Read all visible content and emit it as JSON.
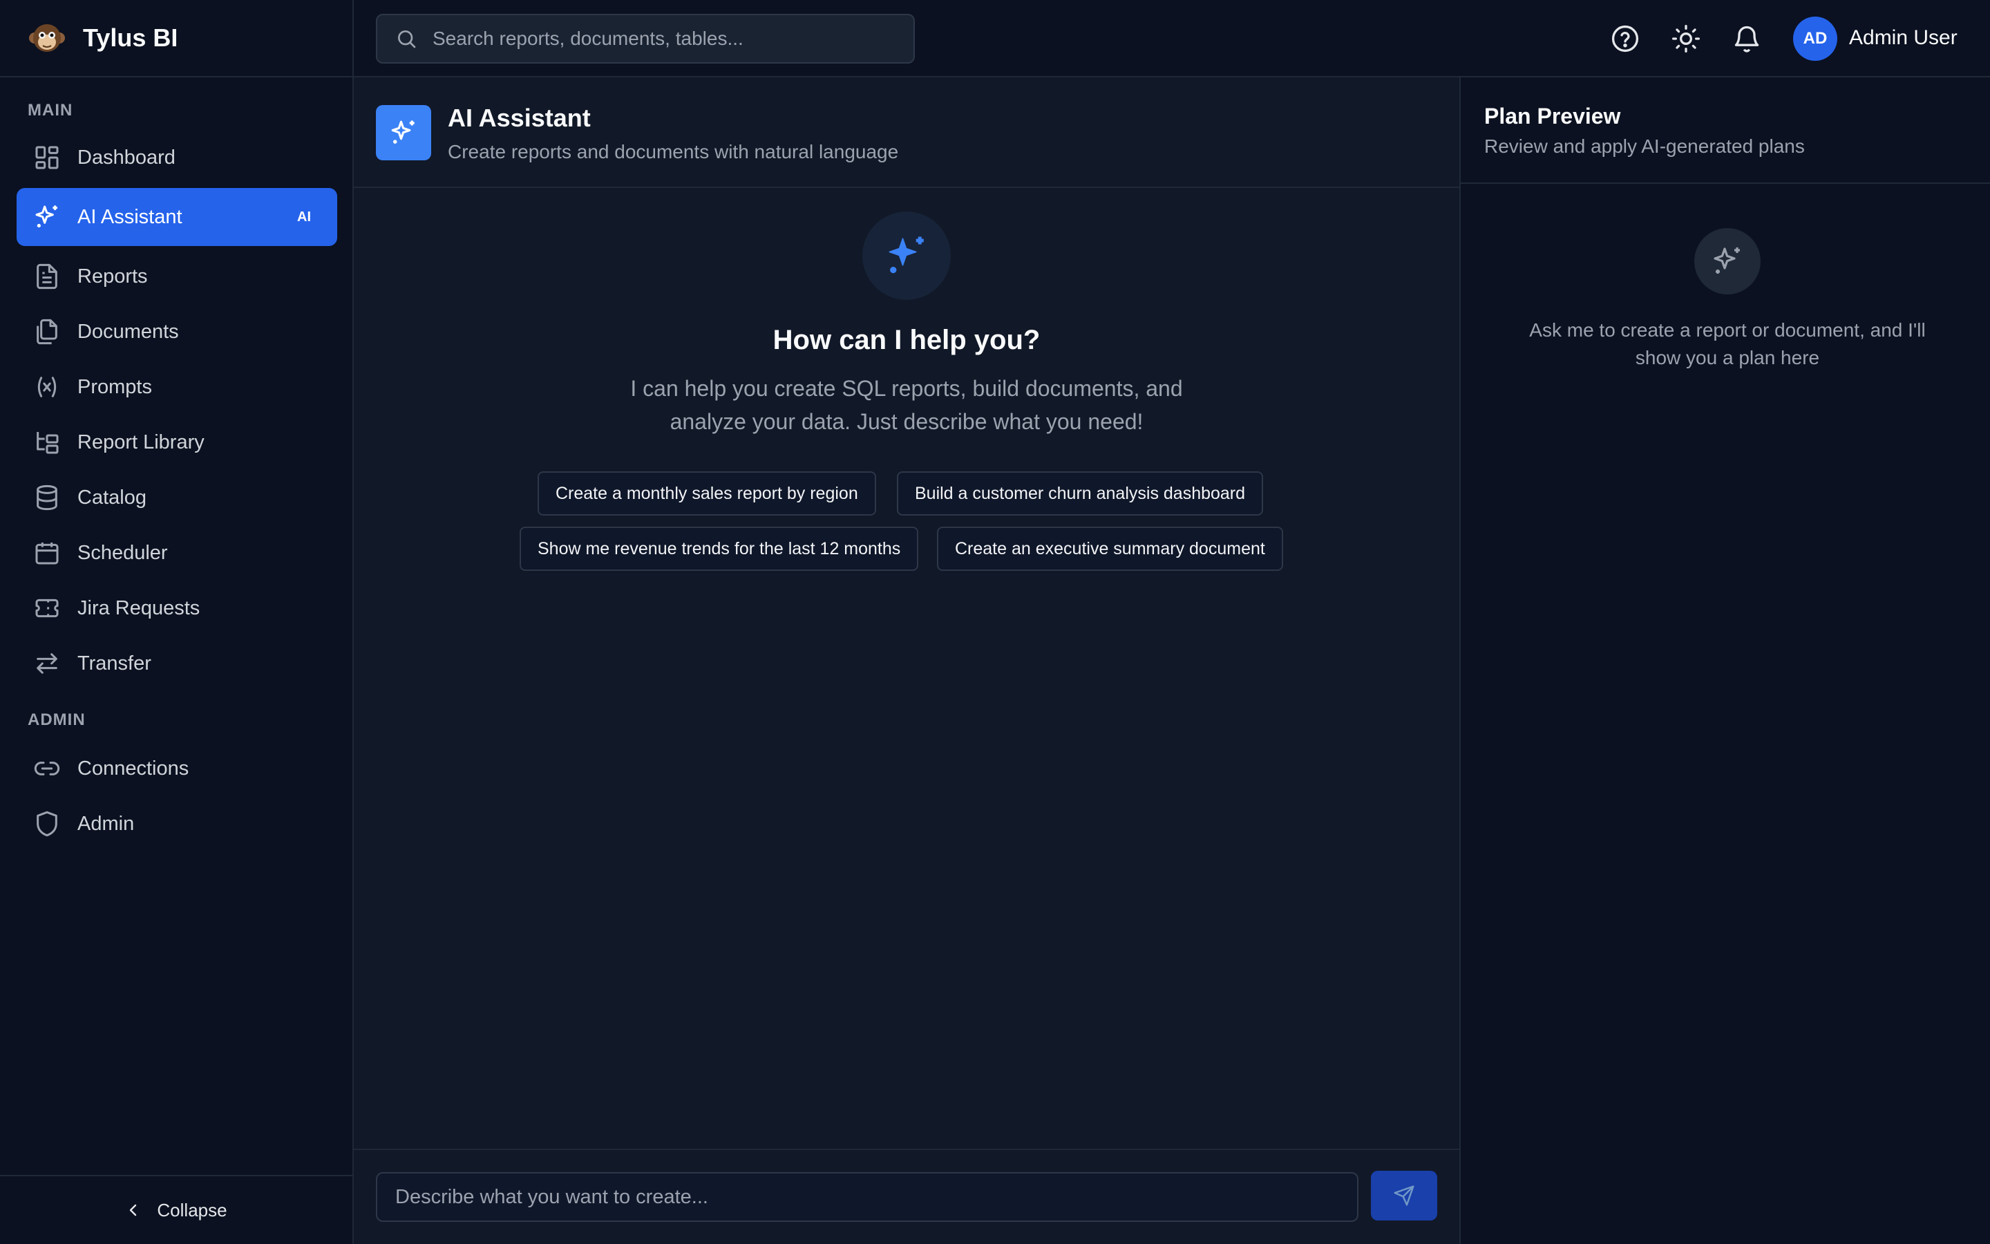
{
  "brand": {
    "name": "Tylus BI"
  },
  "search": {
    "placeholder": "Search reports, documents, tables..."
  },
  "user": {
    "initials": "AD",
    "name": "Admin User"
  },
  "sidebar": {
    "sections": [
      {
        "label": "MAIN"
      },
      {
        "label": "ADMIN"
      }
    ],
    "items": [
      {
        "label": "Dashboard",
        "icon": "dashboard-icon"
      },
      {
        "label": "AI Assistant",
        "icon": "sparkles-icon",
        "badge": "AI",
        "active": true
      },
      {
        "label": "Reports",
        "icon": "file-text-icon"
      },
      {
        "label": "Documents",
        "icon": "files-icon"
      },
      {
        "label": "Prompts",
        "icon": "variable-icon"
      },
      {
        "label": "Report Library",
        "icon": "folder-tree-icon"
      },
      {
        "label": "Catalog",
        "icon": "database-icon"
      },
      {
        "label": "Scheduler",
        "icon": "calendar-icon"
      },
      {
        "label": "Jira Requests",
        "icon": "ticket-icon"
      },
      {
        "label": "Transfer",
        "icon": "transfer-icon"
      },
      {
        "label": "Connections",
        "icon": "link-icon"
      },
      {
        "label": "Admin",
        "icon": "shield-icon"
      }
    ],
    "collapse_label": "Collapse"
  },
  "main": {
    "title": "AI Assistant",
    "subtitle": "Create reports and documents with natural language",
    "welcome": {
      "title": "How can I help you?",
      "text": "I can help you create SQL reports, build documents, and analyze your data. Just describe what you need!"
    },
    "suggestions": [
      "Create a monthly sales report by region",
      "Build a customer churn analysis dashboard",
      "Show me revenue trends for the last 12 months",
      "Create an executive summary document"
    ],
    "composer": {
      "placeholder": "Describe what you want to create..."
    }
  },
  "panel": {
    "title": "Plan Preview",
    "subtitle": "Review and apply AI-generated plans",
    "empty_text": "Ask me to create a report or document, and I'll show you a plan here"
  },
  "colors": {
    "accent": "#2563eb",
    "background": "#111827",
    "sidebar": "#0b1120"
  }
}
